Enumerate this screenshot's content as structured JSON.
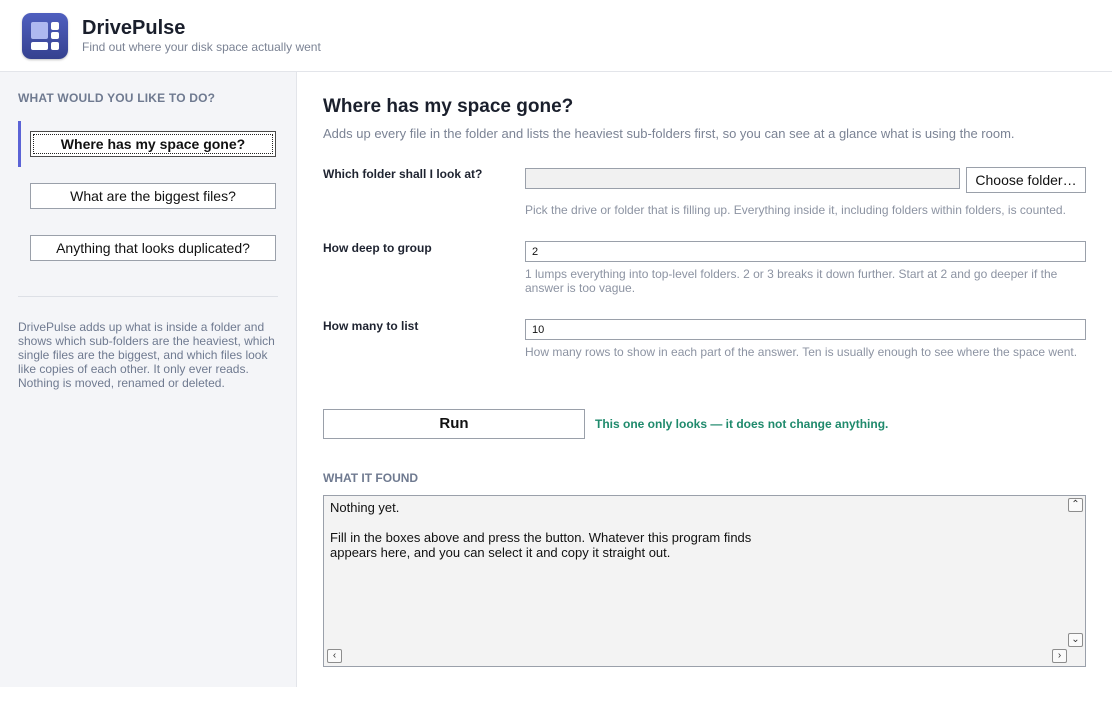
{
  "app": {
    "title": "DrivePulse",
    "subtitle": "Find out where your disk space actually went",
    "logo_icon": "dashboard-grid-icon",
    "accent_color": "#5b63d6"
  },
  "sidebar": {
    "heading": "WHAT WOULD YOU LIKE TO DO?",
    "tasks": [
      {
        "label": "Where has my space gone?",
        "active": true
      },
      {
        "label": "What are the biggest files?",
        "active": false
      },
      {
        "label": "Anything that looks duplicated?",
        "active": false
      }
    ],
    "about": "DrivePulse adds up what is inside a folder and shows which sub-folders are the heaviest, which single files are the biggest, and which files look like copies of each other. It only ever reads. Nothing is moved, renamed or deleted."
  },
  "main": {
    "title": "Where has my space gone?",
    "description": "Adds up every file in the folder and lists the heaviest sub-folders first, so you can see at a glance what is using the room.",
    "fields": {
      "folder": {
        "label": "Which folder shall I look at?",
        "value": "",
        "button_label": "Choose folder…",
        "hint": "Pick the drive or folder that is filling up. Everything inside it, including folders within folders, is counted."
      },
      "depth": {
        "label": "How deep to group",
        "value": "2",
        "hint": "1 lumps everything into top-level folders. 2 or 3 breaks it down further. Start at 2 and go deeper if the answer is too vague."
      },
      "count": {
        "label": "How many to list",
        "value": "10",
        "hint": "How many rows to show in each part of the answer. Ten is usually enough to see where the space went."
      }
    },
    "run_label": "Run",
    "run_note": "This one only looks — it does not change anything.",
    "run_note_color": "#1f8a6c",
    "results_heading": "WHAT IT FOUND",
    "results_text": "Nothing yet.\n\nFill in the boxes above and press the button. Whatever this program finds\nappears here, and you can select it and copy it straight out."
  }
}
